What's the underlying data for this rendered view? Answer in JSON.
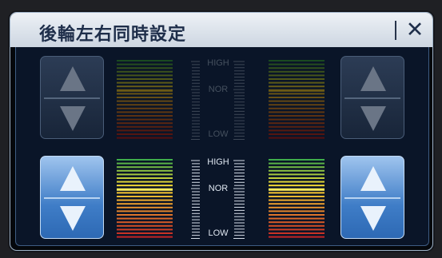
{
  "dialog": {
    "title": "後輪左右同時設定",
    "close_symbol": "✕"
  },
  "rows": [
    {
      "row": "upper",
      "state": "disabled",
      "scale": {
        "high": "HIGH",
        "nor": "NOR",
        "low": "LOW"
      }
    },
    {
      "row": "lower",
      "state": "enabled",
      "scale": {
        "high": "HIGH",
        "nor": "NOR",
        "low": "LOW"
      }
    }
  ],
  "colors": {
    "panel": "#0a1528",
    "button_enabled": "#3f7dc7",
    "button_disabled": "#24344c",
    "level_high": "#3fae4b",
    "level_mid": "#ffdd33",
    "level_low": "#c52424"
  },
  "icons": [
    "close-icon",
    "arrow-up-icon",
    "arrow-down-icon"
  ]
}
